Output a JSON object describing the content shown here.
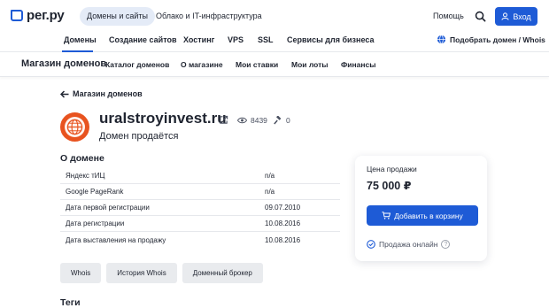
{
  "header": {
    "logo_text": "рег.ру",
    "nav_pills": [
      "Домены и сайты",
      "Облако и IT-инфраструктура"
    ],
    "help_label": "Помощь",
    "login_label": "Вход"
  },
  "subnav": {
    "items": [
      "Домены",
      "Создание сайтов",
      "Хостинг",
      "VPS",
      "SSL",
      "Сервисы для бизнеса"
    ],
    "pick_domain_label": "Подобрать домен / Whois"
  },
  "marketnav": {
    "title": "Магазин доменов",
    "items": [
      "Каталог доменов",
      "О магазине",
      "Мои ставки",
      "Мои лоты",
      "Финансы"
    ]
  },
  "page": {
    "back_label": "Магазин доменов",
    "domain_name": "uralstroyinvest.ru",
    "views_count": "8439",
    "bids_count": "0",
    "subtitle": "Домен продаётся",
    "about_title": "О домене",
    "about_rows": [
      {
        "key": "Яндекс тИЦ",
        "value": "n/a"
      },
      {
        "key": "Google PageRank",
        "value": "n/a"
      },
      {
        "key": "Дата первой регистрации",
        "value": "09.07.2010"
      },
      {
        "key": "Дата регистрации",
        "value": "10.08.2016"
      },
      {
        "key": "Дата выставления на продажу",
        "value": "10.08.2016"
      }
    ],
    "buttons": [
      "Whois",
      "История Whois",
      "Доменный брокер"
    ],
    "tags_title": "Теги"
  },
  "sale_card": {
    "label": "Цена продажи",
    "price": "75 000 ₽",
    "cart_button": "Добавить в корзину",
    "online_label": "Продажа онлайн",
    "help_glyph": "?"
  },
  "colors": {
    "accent": "#1e5bd6",
    "avatar": "#e8531f"
  }
}
